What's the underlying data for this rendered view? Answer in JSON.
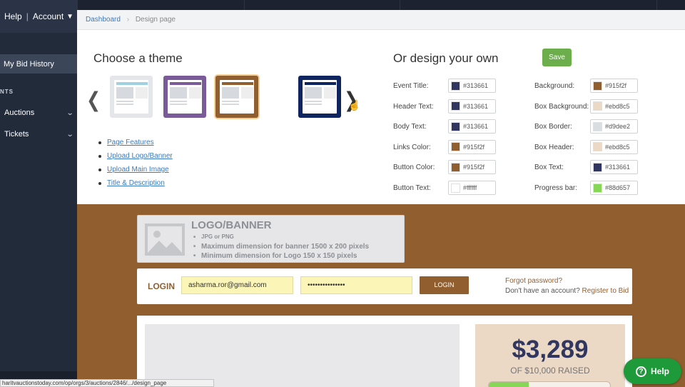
{
  "sidebar": {
    "help": "Help",
    "account": "Account",
    "bid_history": "My Bid History",
    "section": "NTS",
    "items": [
      {
        "label": "Auctions"
      },
      {
        "label": "Tickets"
      }
    ]
  },
  "breadcrumb": {
    "root": "Dashboard",
    "current": "Design page"
  },
  "themes": {
    "title": "Choose a theme",
    "items": [
      {
        "frame": "#e4e6ea",
        "header": "#9fd1e0"
      },
      {
        "frame": "#7b5a9a",
        "header": "#7b5a9a"
      },
      {
        "frame": "#915f2f",
        "header": "#915f2f"
      },
      {
        "frame": "#0f2560",
        "header": "#0f2560"
      }
    ],
    "links": [
      "Page Features",
      "Upload Logo/Banner",
      "Upload Main Image",
      "Title & Description"
    ]
  },
  "design": {
    "title": "Or design your own",
    "save_label": "Save",
    "left": [
      {
        "label": "Event Title:",
        "value": "#313661"
      },
      {
        "label": "Header Text:",
        "value": "#313661"
      },
      {
        "label": "Body Text:",
        "value": "#313661"
      },
      {
        "label": "Links Color:",
        "value": "#915f2f"
      },
      {
        "label": "Button Color:",
        "value": "#915f2f"
      },
      {
        "label": "Button Text:",
        "value": "#ffffff"
      }
    ],
    "right": [
      {
        "label": "Background:",
        "value": "#915f2f"
      },
      {
        "label": "Box Background:",
        "value": "#ebd8c5"
      },
      {
        "label": "Box Border:",
        "value": "#d9dee2"
      },
      {
        "label": "Box Header:",
        "value": "#ebd8c5"
      },
      {
        "label": "Box Text:",
        "value": "#313661"
      },
      {
        "label": "Progress bar:",
        "value": "#88d657"
      }
    ]
  },
  "preview": {
    "logo_title": "LOGO/BANNER",
    "logo_lines": [
      "JPG or PNG",
      "Maximum dimension for banner 1500 x 200 pixels",
      "Minimum dimension for Logo 150 x 150 pixels"
    ],
    "login_label": "LOGIN",
    "email": "asharma.ror@gmail.com",
    "password": "•••••••••••••••",
    "login_button": "LOGIN",
    "forgot": "Forgot password?",
    "no_account": "Don't have an account?",
    "register": "Register to Bid",
    "raised_amount": "$3,289",
    "raised_of": "OF $10,000 RAISED",
    "progress_fraction": 0.33
  },
  "status_url": "haritvauctionstoday.com/op/orgs/3/auctions/2846/.../design_page",
  "help_button": "Help"
}
